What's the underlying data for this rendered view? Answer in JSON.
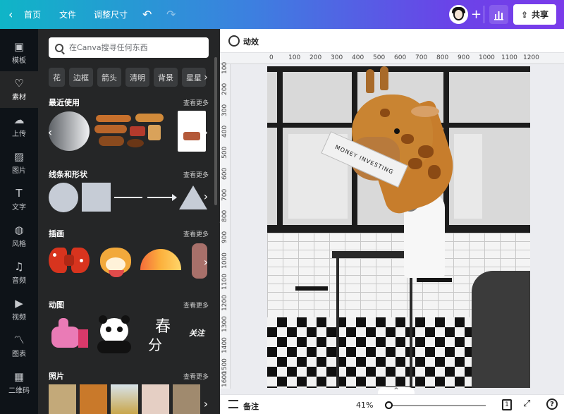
{
  "topbar": {
    "back_icon": "‹",
    "home": "首页",
    "file": "文件",
    "resize": "调整尺寸",
    "undo_icon": "↶",
    "redo_icon": "↷",
    "plus_icon": "+",
    "share": "共享",
    "share_icon": "⇪"
  },
  "rail": [
    {
      "label": "模板",
      "icon": "▣"
    },
    {
      "label": "素材",
      "icon": "♡"
    },
    {
      "label": "上传",
      "icon": "☁"
    },
    {
      "label": "图片",
      "icon": "▨"
    },
    {
      "label": "文字",
      "icon": "T"
    },
    {
      "label": "风格",
      "icon": "◍"
    },
    {
      "label": "音频",
      "icon": "♫"
    },
    {
      "label": "视频",
      "icon": "▶"
    },
    {
      "label": "图表",
      "icon": "〽"
    },
    {
      "label": "二维码",
      "icon": "▦"
    }
  ],
  "panel": {
    "search_placeholder": "在Canva搜寻任何东西",
    "chips": [
      "花",
      "边框",
      "箭头",
      "清明",
      "背景",
      "星星"
    ],
    "chip_next": "›",
    "see_more": "查看更多",
    "sections": {
      "recent": "最近使用",
      "lines_shapes": "线条和形状",
      "illustrations": "插画",
      "animations": "动图",
      "photos": "照片"
    },
    "arrow_left": "‹",
    "arrow_right": "›",
    "animation_text_1": "春",
    "animation_text_2": "分",
    "animation_text_3": "关注",
    "collapse": "‹"
  },
  "canvas": {
    "animate_label": "动效",
    "ruler_top": [
      "0",
      "100",
      "200",
      "300",
      "400",
      "500",
      "600",
      "700",
      "800",
      "900",
      "1000",
      "1100",
      "1200"
    ],
    "ruler_left": [
      "100",
      "200",
      "300",
      "400",
      "500",
      "600",
      "700",
      "800",
      "900",
      "1000",
      "1100",
      "1200",
      "1300",
      "1400",
      "1500",
      "1600"
    ],
    "newspaper_text": "MONEY INVESTING"
  },
  "bottombar": {
    "notes": "备注",
    "zoom": "41%",
    "zoom_fraction": 0.0,
    "page_number": "1",
    "help": "?",
    "fullscreen_icon": "⤢",
    "pages_toggle": "^"
  }
}
